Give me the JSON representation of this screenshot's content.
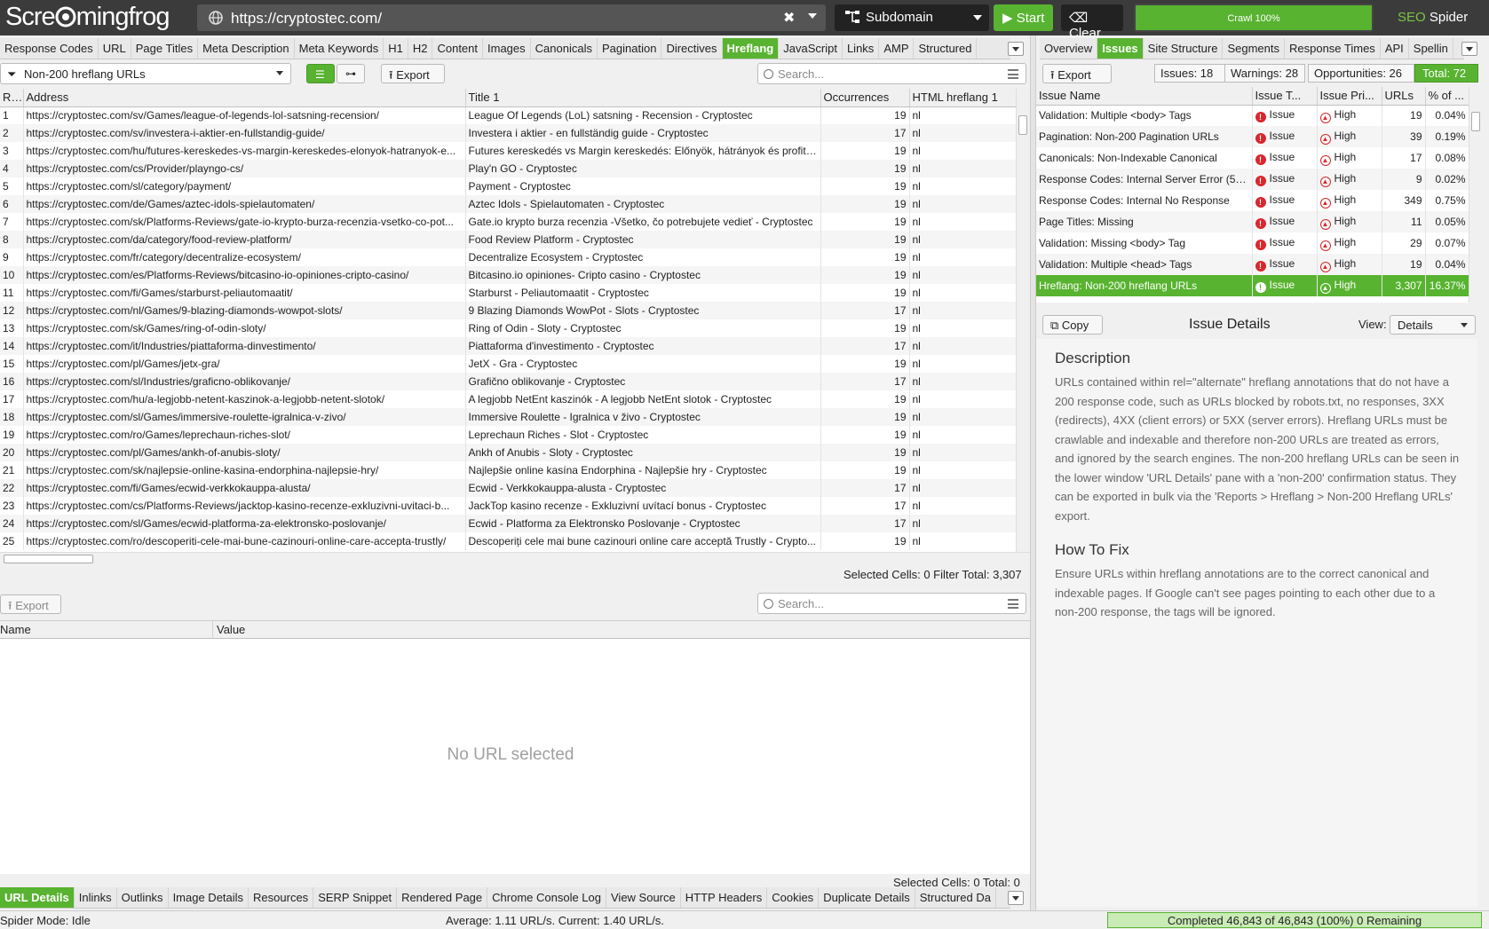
{
  "top": {
    "logo": "ScreamingFrog",
    "url": "https://cryptostec.com/",
    "mode": "Subdomain",
    "start_label": "Start",
    "clear_label": "Clear",
    "crawl_progress_label": "Crawl 100%",
    "crawl_progress": 1.0,
    "brand_seo": "SEO",
    "brand_spider": "Spider",
    "accent_color": "#58b330"
  },
  "main_tabs": [
    "Response Codes",
    "URL",
    "Page Titles",
    "Meta Description",
    "Meta Keywords",
    "H1",
    "H2",
    "Content",
    "Images",
    "Canonicals",
    "Pagination",
    "Directives",
    "Hreflang",
    "JavaScript",
    "Links",
    "AMP",
    "Structured"
  ],
  "main_tabs_active": "Hreflang",
  "filter": {
    "selected": "Non-200 hreflang URLs",
    "export_label": "Export",
    "search_placeholder": "Search..."
  },
  "url_table": {
    "columns": [
      "Row",
      "Address",
      "Title 1",
      "Occurrences",
      "HTML hreflang 1"
    ],
    "rows": [
      [
        "1",
        "https://cryptostec.com/sv/Games/league-of-legends-lol-satsning-recension/",
        "League Of Legends (LoL) satsning - Recension - Cryptostec",
        "19",
        "nl"
      ],
      [
        "2",
        "https://cryptostec.com/sv/investera-i-aktier-en-fullstandig-guide/",
        "Investera i aktier - en fullständig guide - Cryptostec",
        "17",
        "nl"
      ],
      [
        "3",
        "https://cryptostec.com/hu/futures-kereskedes-vs-margin-kereskedes-elonyok-hatranyok-e...",
        "Futures kereskedés vs Margin kereskedés: Előnyök, hátrányok és profit ...",
        "19",
        "nl"
      ],
      [
        "4",
        "https://cryptostec.com/cs/Provider/playngo-cs/",
        "Play'n GO - Cryptostec",
        "19",
        "nl"
      ],
      [
        "5",
        "https://cryptostec.com/sl/category/payment/",
        "Payment - Cryptostec",
        "19",
        "nl"
      ],
      [
        "6",
        "https://cryptostec.com/de/Games/aztec-idols-spielautomaten/",
        "Aztec Idols - Spielautomaten - Cryptostec",
        "19",
        "nl"
      ],
      [
        "7",
        "https://cryptostec.com/sk/Platforms-Reviews/gate-io-krypto-burza-recenzia-vsetko-co-pot...",
        "Gate.io krypto burza recenzia -Všetko, čo potrebujete vedieť - Cryptostec",
        "19",
        "nl"
      ],
      [
        "8",
        "https://cryptostec.com/da/category/food-review-platform/",
        "Food Review Platform - Cryptostec",
        "19",
        "nl"
      ],
      [
        "9",
        "https://cryptostec.com/fr/category/decentralize-ecosystem/",
        "Decentralize Ecosystem - Cryptostec",
        "19",
        "nl"
      ],
      [
        "10",
        "https://cryptostec.com/es/Platforms-Reviews/bitcasino-io-opiniones-cripto-casino/",
        "Bitcasino.io opiniones- Cripto casino - Cryptostec",
        "19",
        "nl"
      ],
      [
        "11",
        "https://cryptostec.com/fi/Games/starburst-peliautomaatit/",
        "Starburst - Peliautomaatit - Cryptostec",
        "19",
        "nl"
      ],
      [
        "12",
        "https://cryptostec.com/nl/Games/9-blazing-diamonds-wowpot-slots/",
        "9 Blazing Diamonds WowPot - Slots - Cryptostec",
        "17",
        "nl"
      ],
      [
        "13",
        "https://cryptostec.com/sk/Games/ring-of-odin-sloty/",
        "Ring of Odin - Sloty - Cryptostec",
        "19",
        "nl"
      ],
      [
        "14",
        "https://cryptostec.com/it/Industries/piattaforma-dinvestimento/",
        "Piattaforma d'investimento - Cryptostec",
        "17",
        "nl"
      ],
      [
        "15",
        "https://cryptostec.com/pl/Games/jetx-gra/",
        "JetX - Gra - Cryptostec",
        "19",
        "nl"
      ],
      [
        "16",
        "https://cryptostec.com/sl/Industries/graficno-oblikovanje/",
        "Grafično oblikovanje - Cryptostec",
        "17",
        "nl"
      ],
      [
        "17",
        "https://cryptostec.com/hu/a-legjobb-netent-kaszinok-a-legjobb-netent-slotok/",
        "A legjobb NetEnt kaszinók - A legjobb NetEnt slotok - Cryptostec",
        "19",
        "nl"
      ],
      [
        "18",
        "https://cryptostec.com/sl/Games/immersive-roulette-igralnica-v-zivo/",
        "Immersive Roulette - Igralnica v živo - Cryptostec",
        "19",
        "nl"
      ],
      [
        "19",
        "https://cryptostec.com/ro/Games/leprechaun-riches-slot/",
        "Leprechaun Riches - Slot - Cryptostec",
        "19",
        "nl"
      ],
      [
        "20",
        "https://cryptostec.com/pl/Games/ankh-of-anubis-sloty/",
        "Ankh of Anubis - Sloty - Cryptostec",
        "19",
        "nl"
      ],
      [
        "21",
        "https://cryptostec.com/sk/najlepsie-online-kasina-endorphina-najlepsie-hry/",
        "Najlepšie online kasína Endorphina - Najlepšie hry - Cryptostec",
        "19",
        "nl"
      ],
      [
        "22",
        "https://cryptostec.com/fi/Games/ecwid-verkkokauppa-alusta/",
        "Ecwid - Verkkokauppa-alusta - Cryptostec",
        "17",
        "nl"
      ],
      [
        "23",
        "https://cryptostec.com/cs/Platforms-Reviews/jacktop-kasino-recenze-exkluzivni-uvitaci-b...",
        "JackTop kasino recenze - Exkluzivní uvítací bonus - Cryptostec",
        "17",
        "nl"
      ],
      [
        "24",
        "https://cryptostec.com/sl/Games/ecwid-platforma-za-elektronsko-poslovanje/",
        "Ecwid - Platforma za Elektronsko Poslovanje - Cryptostec",
        "17",
        "nl"
      ],
      [
        "25",
        "https://cryptostec.com/ro/descoperiti-cele-mai-bune-cazinouri-online-care-accepta-trustly/",
        "Descoperiți cele mai bune cazinouri online care acceptă Trustly - Crypto...",
        "19",
        "nl"
      ]
    ],
    "status": "Selected Cells:  0  Filter Total:  3,307"
  },
  "lower": {
    "export_label": "Export",
    "search_placeholder": "Search...",
    "columns": [
      "Name",
      "Value"
    ],
    "empty_text": "No URL selected",
    "status": "Selected Cells:  0  Total:  0",
    "tabs": [
      "URL Details",
      "Inlinks",
      "Outlinks",
      "Image Details",
      "Resources",
      "SERP Snippet",
      "Rendered Page",
      "Chrome Console Log",
      "View Source",
      "HTTP Headers",
      "Cookies",
      "Duplicate Details",
      "Structured Da"
    ],
    "tabs_active": "URL Details"
  },
  "right_tabs": [
    "Overview",
    "Issues",
    "Site Structure",
    "Segments",
    "Response Times",
    "API",
    "Spellin"
  ],
  "right_tabs_active": "Issues",
  "issues": {
    "export_label": "Export",
    "summary": {
      "issues": "Issues: 18",
      "warnings": "Warnings: 28",
      "opportunities": "Opportunities: 26",
      "total": "Total: 72"
    },
    "columns": [
      "Issue Name",
      "Issue T...",
      "Issue Pri...",
      "URLs",
      "% of ..."
    ],
    "rows": [
      [
        "Validation: Multiple <body> Tags",
        "Issue",
        "High",
        "19",
        "0.04%"
      ],
      [
        "Pagination: Non-200 Pagination URLs",
        "Issue",
        "High",
        "39",
        "0.19%"
      ],
      [
        "Canonicals: Non-Indexable Canonical",
        "Issue",
        "High",
        "17",
        "0.08%"
      ],
      [
        "Response Codes: Internal Server Error (5xx)",
        "Issue",
        "High",
        "9",
        "0.02%"
      ],
      [
        "Response Codes: Internal No Response",
        "Issue",
        "High",
        "349",
        "0.75%"
      ],
      [
        "Page Titles: Missing",
        "Issue",
        "High",
        "11",
        "0.05%"
      ],
      [
        "Validation: Missing <body> Tag",
        "Issue",
        "High",
        "29",
        "0.07%"
      ],
      [
        "Validation: Multiple <head> Tags",
        "Issue",
        "High",
        "19",
        "0.04%"
      ],
      [
        "Hreflang: Non-200 hreflang URLs",
        "Issue",
        "High",
        "3,307",
        "16.37%"
      ]
    ],
    "selected_index": 8
  },
  "details": {
    "copy_label": "Copy",
    "title": "Issue Details",
    "view_label": "View:",
    "view_value": "Details",
    "description_heading": "Description",
    "description": "URLs contained within rel=\"alternate\" hreflang annotations that do not have a 200 response code, such as URLs blocked by robots.txt, no responses, 3XX (redirects), 4XX (client errors) or 5XX (server errors). Hreflang URLs must be crawlable and indexable and therefore non-200 URLs are treated as errors, and ignored by the search engines. The non-200 hreflang URLs can be seen in the lower window 'URL Details' pane with a 'non-200' confirmation status. They can be exported in bulk via the 'Reports > Hreflang > Non-200 Hreflang URLs' export.",
    "fix_heading": "How To Fix",
    "fix": "Ensure URLs within hreflang annotations are to the correct canonical and indexable pages. If Google can't see pages pointing to each other due to a non-200 response, the tags will be ignored."
  },
  "statusbar": {
    "mode": "Spider Mode: Idle",
    "rate": "Average: 1.11 URL/s. Current: 1.40 URL/s.",
    "completed": "Completed 46,843 of 46,843 (100%) 0 Remaining"
  }
}
